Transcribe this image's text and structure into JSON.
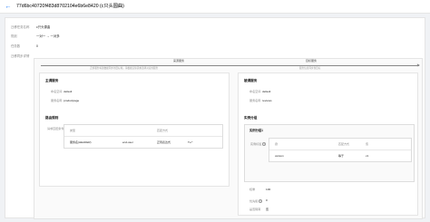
{
  "header": {
    "back_icon": "arrow-left-icon",
    "title": "77d6bc40720f483d8702104e6b6e8420 (c只头圆曲)"
  },
  "info": {
    "rows": [
      {
        "label": "迁移任务名称",
        "value": "c只头源曲"
      },
      {
        "label": "规划",
        "value": "一对一 → 一对多"
      },
      {
        "label": "任务数",
        "value": "0"
      },
      {
        "label": "迁移同步详情",
        "value": ""
      }
    ]
  },
  "flow": {
    "source_label": "来源服务",
    "source_desc": "迁移服务将源数据同步到目标端，请根据实际需求选择对应的服务",
    "target_label": "目标服务",
    "target_desc": "服务信息同步到目标",
    "arrow_icon": "arrow-right-icon"
  },
  "source_panel": {
    "title": "主调服务",
    "fields": [
      {
        "label": "命名空间",
        "value": "default"
      },
      {
        "label": "服务名称",
        "value": "productpage"
      }
    ],
    "sub_title": "路由规则",
    "table_label": "请求匹配条件",
    "rows": [
      {
        "k1": "类型",
        "v1": "",
        "k2": "匹配方式",
        "v2": ""
      },
      {
        "k1": "服务名(HEADER)",
        "v1": "end-user",
        "k2": "正则表达式",
        "v2": "Tu.*"
      }
    ]
  },
  "target_panel": {
    "title": "被调服务",
    "fields": [
      {
        "label": "命名空间",
        "value": "default"
      },
      {
        "label": "服务名称",
        "value": "reviews"
      }
    ],
    "sub_title": "实例分组",
    "group_title": "实例分组1",
    "group_label": "实例标签",
    "rows": [
      {
        "k1": "键",
        "v1": "",
        "k2": "匹配方式",
        "v2": "值"
      },
      {
        "k1": "version",
        "v1": "",
        "k2": "等于",
        "v2": "v1"
      }
    ],
    "extra": [
      {
        "label": "权重",
        "value": "100"
      },
      {
        "label": "优先级",
        "value": "0"
      },
      {
        "label": "是否隔离",
        "value": "否"
      }
    ]
  }
}
